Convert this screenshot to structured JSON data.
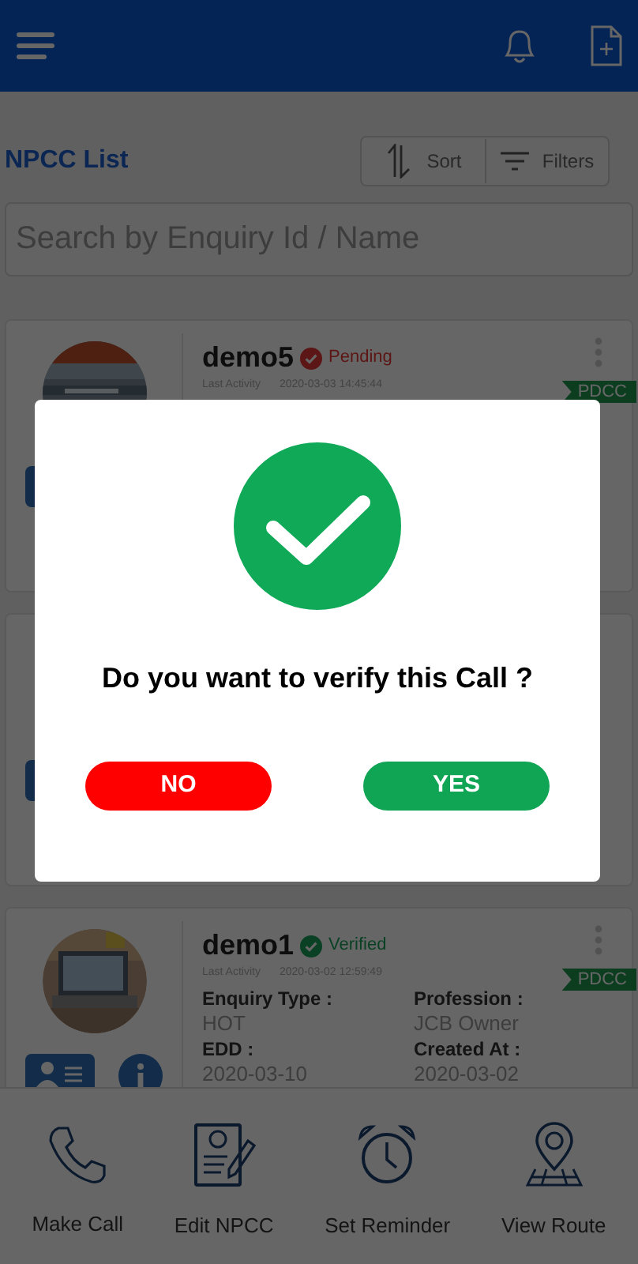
{
  "header": {
    "title": "NPCC List"
  },
  "toolbar": [
    {
      "label": "Sort",
      "kind": "sort"
    },
    {
      "label": "Filters",
      "kind": "filter"
    }
  ],
  "search": {
    "placeholder": "Search by Enquiry Id / Name"
  },
  "cards": [
    {
      "name": "demo5",
      "status": {
        "label": "Pending",
        "kind": "pending"
      },
      "last_activity_label": "Last Activity",
      "last_activity": "2020-03-03 14:45:44",
      "ribbon": "PDCC"
    },
    {
      "kind": "card"
    },
    {
      "name": "demo1",
      "status": {
        "label": "Verified",
        "kind": "verified"
      },
      "last_activity_label": "Last Activity",
      "last_activity": "2020-03-02 12:59:49",
      "ribbon": "PDCC",
      "fields": [
        {
          "label": "Enquiry Type :",
          "value": "HOT"
        },
        {
          "label": "Profession :",
          "value": "JCB Owner"
        },
        {
          "label": "EDD :",
          "value": "2020-03-10"
        },
        {
          "label": "Created At :",
          "value": "2020-03-02"
        }
      ]
    }
  ],
  "bottom_nav": [
    {
      "label": "Make Call",
      "kind": "phone"
    },
    {
      "label": "Edit NPCC",
      "kind": "edit"
    },
    {
      "label": "Set Reminder",
      "kind": "alarm"
    },
    {
      "label": "View Route",
      "kind": "route"
    }
  ],
  "dialog": {
    "message": "Do you want to verify this Call ?",
    "buttons": [
      {
        "label": "NO",
        "kind": "negative"
      },
      {
        "label": "YES",
        "kind": "positive"
      }
    ]
  }
}
